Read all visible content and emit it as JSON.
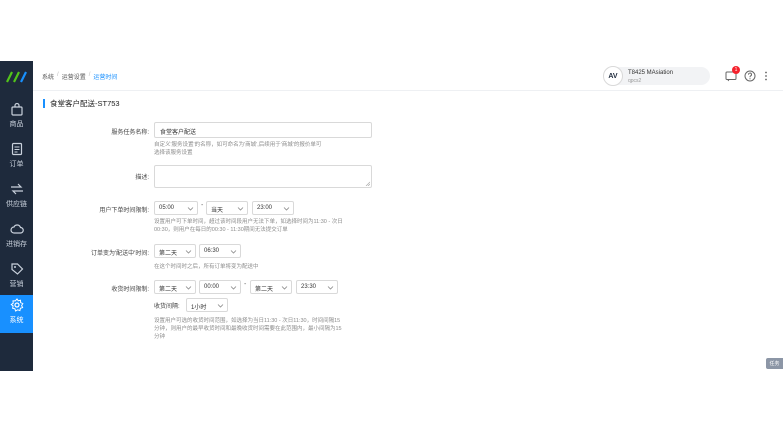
{
  "colors": {
    "sidebar_bg": "#1e2a3c",
    "accent": "#1890ff",
    "badge": "#f5222d"
  },
  "sidebar": {
    "items": [
      {
        "label": "商品",
        "icon": "bag-icon"
      },
      {
        "label": "订单",
        "icon": "document-icon"
      },
      {
        "label": "供应链",
        "icon": "exchange-icon"
      },
      {
        "label": "进销存",
        "icon": "cloud-icon"
      },
      {
        "label": "营销",
        "icon": "tag-icon"
      },
      {
        "label": "系统",
        "icon": "gear-icon",
        "active": true
      }
    ]
  },
  "header": {
    "breadcrumb": [
      "系统",
      "运营设置",
      "运营时间"
    ],
    "account": {
      "avatar": "AV",
      "name": "T8425 MAsiation",
      "sub": "qpcs2"
    },
    "notification_count": "1"
  },
  "page": {
    "title": "食堂客户配送-ST753",
    "form": {
      "service_name": {
        "label": "服务任务名称:",
        "value": "食堂客户配送",
        "help": [
          "自定义'服务设置'的名称，如可命名为'商城',后续用于'商城'的报价单可",
          "选择该服务设置"
        ]
      },
      "description": {
        "label": "描述:"
      },
      "order_time": {
        "label": "用户下单时间限制:",
        "start": "05:00",
        "day": "当天",
        "end": "23:00",
        "help": [
          "设置用户可下单时间，超过该时间段用户无法下单，如选择时间为11:30 - 次日",
          "00:30，则用户在每日的00:30 - 11:30期间无法提交订单"
        ]
      },
      "dispatch_time": {
        "label": "订单变为'配送中'时间:",
        "day": "第二天",
        "time": "06:30",
        "help": "在这个时间时之后，所有订单将变为配送中"
      },
      "receive_time": {
        "label": "收货时间限制:",
        "start_day": "第二天",
        "start": "00:00",
        "end_day": "第二天",
        "end": "23:30",
        "interval_label": "收货间隔:",
        "interval": "1小时",
        "help": [
          "设置用户可选的收货时间范围，如选择为当日11:30 - 次日11:30，时间间隔15",
          "分钟，则用户的最早收货时间和最晚收货时间需要在此范围内，最小间隔为15",
          "分钟"
        ]
      }
    }
  },
  "task_button": "任务"
}
